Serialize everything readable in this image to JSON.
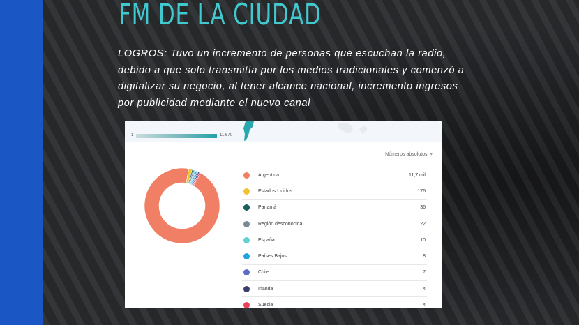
{
  "title": "FM DE LA CIUDAD",
  "achievements": "LOGROS: Tuvo un incremento de personas que escuchan la radio, debido a que solo transmitía por los medios tradicionales y comenzó a digitalizar su negocio, al tener alcance nacional, incremento ingresos por publicidad mediante el nuevo canal",
  "map_legend": {
    "min": "1",
    "max": "11.670"
  },
  "mode_select": {
    "label": "Números absolutos",
    "icon": "chevron-down-icon"
  },
  "colors": {
    "accent_title": "#40c9cf",
    "left_bar": "#1a56c4"
  },
  "chart_data": {
    "type": "pie",
    "categories": [
      "Argentina",
      "Estados Unidos",
      "Panamá",
      "Región desconocida",
      "España",
      "Países Bajos",
      "Chile",
      "Irlanda",
      "Suecia"
    ],
    "values": [
      11700,
      176,
      36,
      22,
      10,
      8,
      7,
      4,
      4
    ],
    "value_labels": [
      "11,7 mil",
      "176",
      "36",
      "22",
      "10",
      "8",
      "7",
      "4",
      "4"
    ],
    "colors": [
      "#f07f66",
      "#f1c232",
      "#1e5e5e",
      "#7a8a93",
      "#62d1d1",
      "#1fa4e0",
      "#5b6dc9",
      "#3c3f6d",
      "#ea4058"
    ]
  }
}
